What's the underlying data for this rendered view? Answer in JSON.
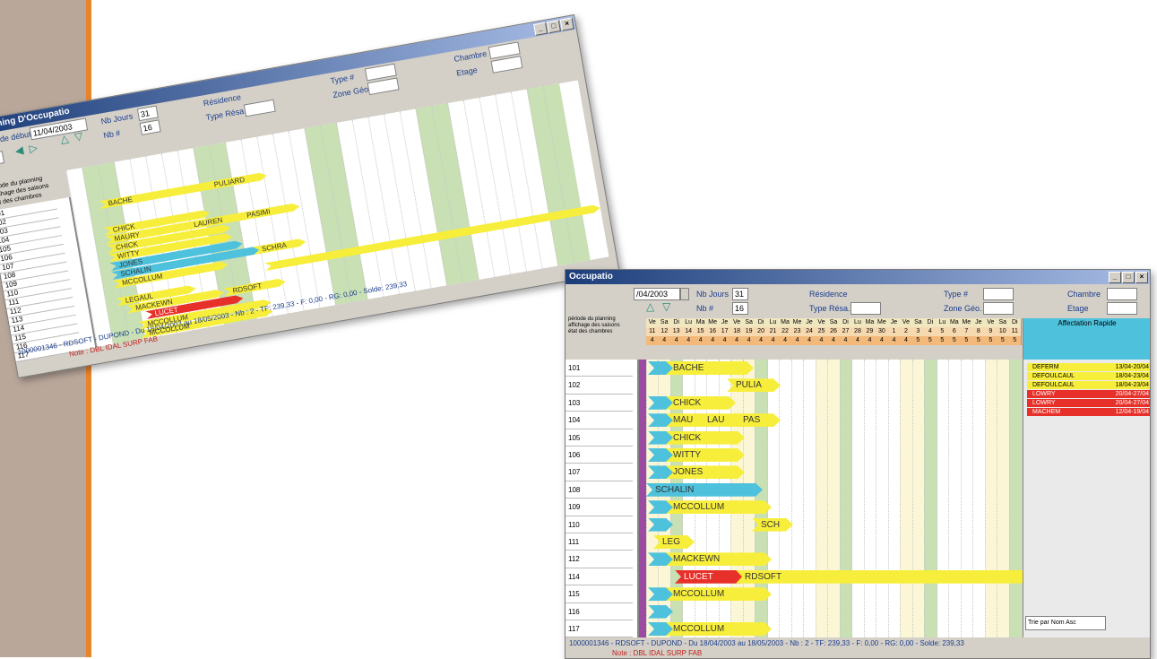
{
  "colors": {
    "accent": "#1c3d7a",
    "reservation_yellow": "#f7ee3c",
    "reservation_cyan": "#4ec1dc",
    "reservation_red": "#e8302a",
    "weekend_green": "#c8e0b4"
  },
  "back_window": {
    "title": "Planning D'Occupatio",
    "date_label": "Date de début",
    "date_value": "11/04/2003",
    "nbjours_label": "Nb Jours",
    "nbjours_value": "31",
    "nb_label": "Nb #",
    "nb_value": "16",
    "residence_label": "Résidence",
    "typeresa_label": "Type Résa.",
    "type_label": "Type #",
    "zone_label": "Zone Géo.",
    "chambre_label": "Chambre",
    "etage_label": "Etage",
    "small_value": "31",
    "menu1": "période du planning",
    "menu2": "affichage des saisons",
    "menu3": "état des chambres",
    "status": "1000001346 - RDSOFT - DUPOND - Du 18/04/2003 au 18/05/2003 - Nb : 2 - TF: 239,33 - F: 0,00 - RG: 0,00 - Solde: 239,33",
    "note": "Note : DBL IDAL SURP FAB",
    "rooms": [
      "101",
      "102",
      "103",
      "104",
      "105",
      "106",
      "107",
      "108",
      "109",
      "110",
      "111",
      "112",
      "113",
      "114",
      "115",
      "116",
      "117"
    ],
    "reservations": [
      "BACHE",
      "PULIARD",
      "CHICK",
      "MAURY",
      "LAUREN",
      "PASIMI",
      "CHICK",
      "WITTY",
      "JONES",
      "SCHALIN",
      "SCHRA",
      "MCCOLLUM",
      "LEGAUL",
      "MACKEWN",
      "RDSOFT",
      "LUCET",
      "MCCOLLUM",
      "MCCOLLUM"
    ]
  },
  "front_window": {
    "title": "Occupatio",
    "date_value": "/04/2003",
    "nbjours_label": "Nb Jours",
    "nbjours_value": "31",
    "nb_label": "Nb #",
    "nb_value": "16",
    "residence_label": "Résidence",
    "typeresa_label": "Type Résa.",
    "type_label": "Type #",
    "zone_label": "Zone Géo.",
    "chambre_label": "Chambre",
    "etage_label": "Etage",
    "menu1": "période du planning",
    "menu2": "affichage des saisons",
    "menu3": "état des chambres",
    "day_names": [
      "Ve",
      "Sa",
      "Di",
      "Lu",
      "Ma",
      "Me",
      "Je",
      "Ve",
      "Sa",
      "Di",
      "Lu",
      "Ma",
      "Me",
      "Je",
      "Ve",
      "Sa",
      "Di",
      "Lu",
      "Ma",
      "Me",
      "Je",
      "Ve",
      "Sa",
      "Di",
      "Lu",
      "Ma",
      "Me",
      "Je",
      "Ve",
      "Sa",
      "Di"
    ],
    "day_numbers": [
      "11",
      "12",
      "13",
      "14",
      "15",
      "16",
      "17",
      "18",
      "19",
      "20",
      "21",
      "22",
      "23",
      "24",
      "25",
      "26",
      "27",
      "28",
      "29",
      "30",
      "1",
      "2",
      "3",
      "4",
      "5",
      "6",
      "7",
      "8",
      "9",
      "10",
      "11"
    ],
    "counts": [
      "4",
      "4",
      "4",
      "4",
      "4",
      "4",
      "4",
      "4",
      "4",
      "4",
      "4",
      "4",
      "4",
      "4",
      "4",
      "4",
      "4",
      "4",
      "4",
      "4",
      "4",
      "4",
      "5",
      "5",
      "5",
      "5",
      "5",
      "5",
      "5",
      "5",
      "5"
    ],
    "rooms": [
      "101",
      "102",
      "103",
      "104",
      "105",
      "106",
      "107",
      "108",
      "109",
      "110",
      "111",
      "112",
      "114",
      "115",
      "116",
      "117"
    ],
    "reservations": {
      "r101": "BACHE",
      "r102": "PULIA",
      "r103": "CHICK",
      "r104a": "MAU",
      "r104b": "LAU",
      "r104c": "PAS",
      "r105": "CHICK",
      "r106": "WITTY",
      "r107": "JONES",
      "r108": "SCHALIN",
      "r109": "MCCOLLUM",
      "r110": "SCH",
      "r111": "LEG",
      "r112": "MACKEWN",
      "r114a": "LUCET",
      "r114b": "RDSOFT",
      "r115": "MCCOLLUM",
      "r117": "MCCOLLUM"
    },
    "panel_title": "Affectation Rapide",
    "quick": [
      {
        "name": "DEFERM",
        "dates": "13/04-20/04"
      },
      {
        "name": "DEFOULCAUL",
        "dates": "18/04-23/04"
      },
      {
        "name": "DEFOULCAUL",
        "dates": "18/04-23/04"
      },
      {
        "name": "LOWRY",
        "dates": "20/04-27/04"
      },
      {
        "name": "LOWRY",
        "dates": "20/04-27/04"
      },
      {
        "name": "MACHEM",
        "dates": "12/04-19/04"
      }
    ],
    "sort_label": "Trie par Nom Asc",
    "status": "1000001346 - RDSOFT - DUPOND - Du 18/04/2003 au 18/05/2003 - Nb : 2 - TF: 239,33 - F: 0,00 - RG: 0,00 - Solde: 239,33",
    "note": "Note : DBL IDAL SURP FAB"
  }
}
